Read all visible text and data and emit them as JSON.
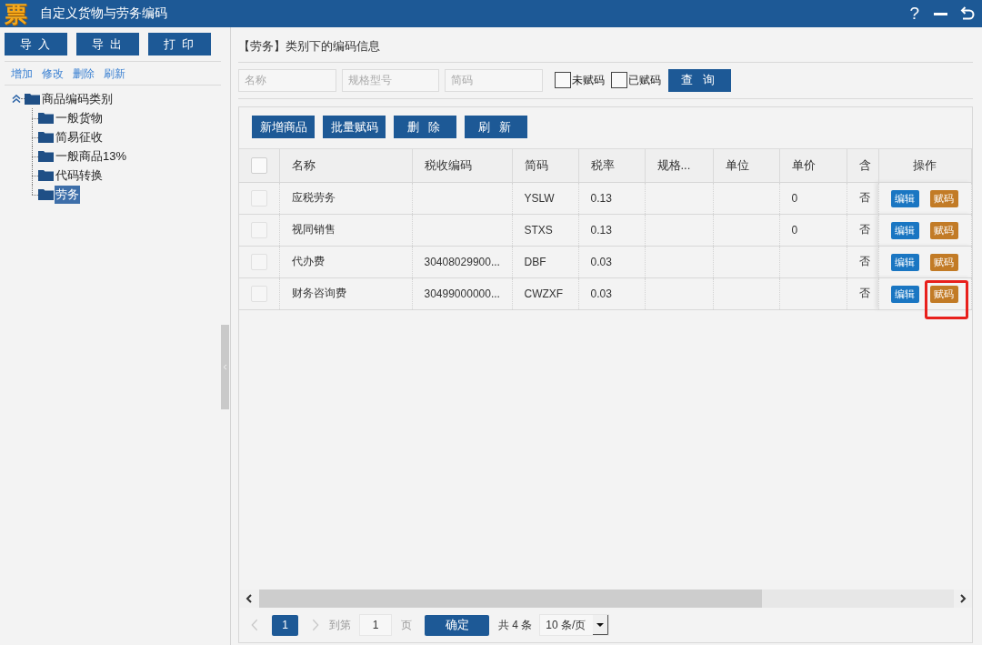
{
  "window": {
    "logo": "票",
    "title": "自定义货物与劳务编码",
    "help": "?"
  },
  "sidebar": {
    "buttons": [
      "导 入",
      "导 出",
      "打 印"
    ],
    "links": [
      "增加",
      "修改",
      "删除",
      "刷新"
    ],
    "tree": {
      "label": "商品编码类别",
      "expanded": true,
      "selected": false,
      "children": [
        {
          "label": "一般货物",
          "selected": false
        },
        {
          "label": "简易征收",
          "selected": false
        },
        {
          "label": "一般商品13%",
          "selected": false
        },
        {
          "label": "代码转换",
          "selected": false
        },
        {
          "label": "劳务",
          "selected": true
        }
      ]
    }
  },
  "content": {
    "heading": "【劳务】类别下的编码信息",
    "filters": [
      {
        "placeholder": "名称"
      },
      {
        "placeholder": "规格型号"
      },
      {
        "placeholder": "简码"
      }
    ],
    "checkboxes": [
      {
        "label": "未赋码",
        "checked": false
      },
      {
        "label": "已赋码",
        "checked": false
      }
    ],
    "query_button": "查 询"
  },
  "toolbar": [
    "新增商品",
    "批量赋码",
    "删 除",
    "刷 新"
  ],
  "table": {
    "select_all_checked": false,
    "columns": [
      "名称",
      "税收编码",
      "简码",
      "税率",
      "规格...",
      "单位",
      "单价",
      "含",
      "操作"
    ],
    "rows": [
      {
        "checked": false,
        "name": "应税劳务",
        "short_code": "YSLW",
        "tax_rate": "0.13",
        "unit_price": "0",
        "column_9": "否",
        "edit_button": "编辑",
        "assign_button": "赋码",
        "assign_highlighted": false
      },
      {
        "checked": false,
        "name": "视同销售",
        "short_code": "STXS",
        "tax_rate": "0.13",
        "unit_price": "0",
        "column_9": "否",
        "edit_button": "编辑",
        "assign_button": "赋码",
        "assign_highlighted": false
      },
      {
        "checked": false,
        "name": "代办费",
        "tax_code": "30408029900...",
        "short_code": "DBF",
        "tax_rate": "0.03",
        "column_9": "否",
        "edit_button": "编辑",
        "assign_button": "赋码",
        "assign_highlighted": false
      },
      {
        "checked": false,
        "name": "财务咨询费",
        "tax_code": "30499000000...",
        "short_code": "CWZXF",
        "tax_rate": "0.03",
        "column_9": "否",
        "edit_button": "编辑",
        "assign_button": "赋码",
        "assign_highlighted": true
      }
    ]
  },
  "pagination": {
    "current_page": "1",
    "goto_label": "到第",
    "goto_value": "1",
    "page_label": "页",
    "confirm_button": "确定",
    "total": "共 4 条",
    "page_size": "10 条/页"
  }
}
